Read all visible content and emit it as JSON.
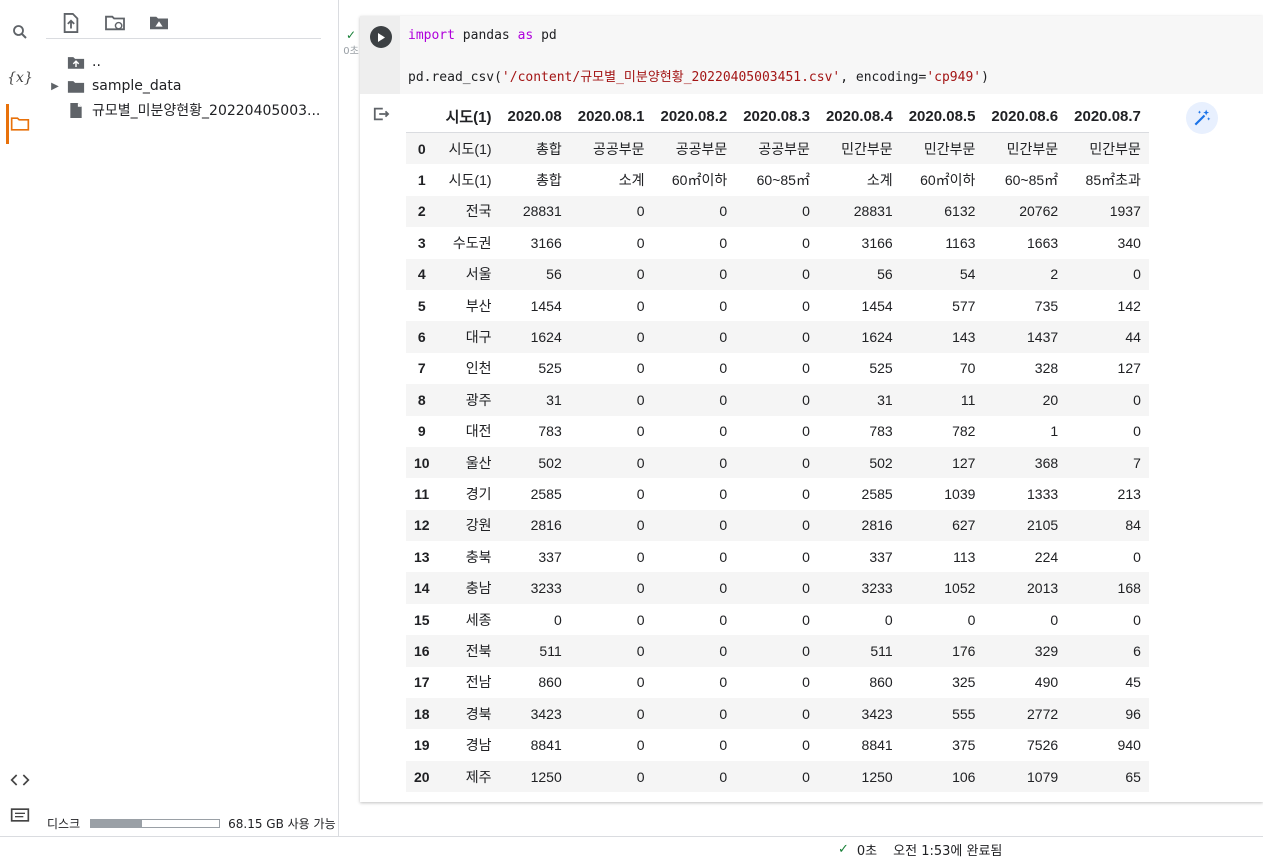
{
  "rail": {
    "icons": [
      "search-icon",
      "variables-icon",
      "folder-icon",
      "code-snippets-icon",
      "terminal-icon"
    ],
    "variables_label": "{x}"
  },
  "files": {
    "toolbar": [
      "upload-icon",
      "refresh-icon",
      "drive-icon"
    ],
    "items": [
      {
        "label": "..",
        "icon": "folder-up-icon"
      },
      {
        "label": "sample_data",
        "icon": "folder-icon"
      },
      {
        "label": "규모별_미분양현황_20220405003...",
        "icon": "file-icon"
      }
    ],
    "disk": {
      "label": "디스크",
      "usage_fraction": 0.4,
      "free_text": "68.15 GB 사용 가능"
    }
  },
  "cell": {
    "status": {
      "check": "✓",
      "time": "0초"
    },
    "code": {
      "line1": {
        "kw1": "import",
        "mid": " pandas ",
        "kw2": "as",
        "end": " pd"
      },
      "line2": {
        "pre": "pd.read_csv(",
        "str1": "'/content/규모별_미분양현황_20220405003451.csv'",
        "mid": ", encoding=",
        "str2": "'cp949'",
        "end": ")"
      }
    }
  },
  "table": {
    "columns": [
      "",
      "시도(1)",
      "2020.08",
      "2020.08.1",
      "2020.08.2",
      "2020.08.3",
      "2020.08.4",
      "2020.08.5",
      "2020.08.6",
      "2020.08.7"
    ],
    "rows": [
      [
        "0",
        "시도(1)",
        "총합",
        "공공부문",
        "공공부문",
        "공공부문",
        "민간부문",
        "민간부문",
        "민간부문",
        "민간부문"
      ],
      [
        "1",
        "시도(1)",
        "총합",
        "소계",
        "60㎡이하",
        "60~85㎡",
        "소계",
        "60㎡이하",
        "60~85㎡",
        "85㎡초과"
      ],
      [
        "2",
        "전국",
        "28831",
        "0",
        "0",
        "0",
        "28831",
        "6132",
        "20762",
        "1937"
      ],
      [
        "3",
        "수도권",
        "3166",
        "0",
        "0",
        "0",
        "3166",
        "1163",
        "1663",
        "340"
      ],
      [
        "4",
        "서울",
        "56",
        "0",
        "0",
        "0",
        "56",
        "54",
        "2",
        "0"
      ],
      [
        "5",
        "부산",
        "1454",
        "0",
        "0",
        "0",
        "1454",
        "577",
        "735",
        "142"
      ],
      [
        "6",
        "대구",
        "1624",
        "0",
        "0",
        "0",
        "1624",
        "143",
        "1437",
        "44"
      ],
      [
        "7",
        "인천",
        "525",
        "0",
        "0",
        "0",
        "525",
        "70",
        "328",
        "127"
      ],
      [
        "8",
        "광주",
        "31",
        "0",
        "0",
        "0",
        "31",
        "11",
        "20",
        "0"
      ],
      [
        "9",
        "대전",
        "783",
        "0",
        "0",
        "0",
        "783",
        "782",
        "1",
        "0"
      ],
      [
        "10",
        "울산",
        "502",
        "0",
        "0",
        "0",
        "502",
        "127",
        "368",
        "7"
      ],
      [
        "11",
        "경기",
        "2585",
        "0",
        "0",
        "0",
        "2585",
        "1039",
        "1333",
        "213"
      ],
      [
        "12",
        "강원",
        "2816",
        "0",
        "0",
        "0",
        "2816",
        "627",
        "2105",
        "84"
      ],
      [
        "13",
        "충북",
        "337",
        "0",
        "0",
        "0",
        "337",
        "113",
        "224",
        "0"
      ],
      [
        "14",
        "충남",
        "3233",
        "0",
        "0",
        "0",
        "3233",
        "1052",
        "2013",
        "168"
      ],
      [
        "15",
        "세종",
        "0",
        "0",
        "0",
        "0",
        "0",
        "0",
        "0",
        "0"
      ],
      [
        "16",
        "전북",
        "511",
        "0",
        "0",
        "0",
        "511",
        "176",
        "329",
        "6"
      ],
      [
        "17",
        "전남",
        "860",
        "0",
        "0",
        "0",
        "860",
        "325",
        "490",
        "45"
      ],
      [
        "18",
        "경북",
        "3423",
        "0",
        "0",
        "0",
        "3423",
        "555",
        "2772",
        "96"
      ],
      [
        "19",
        "경남",
        "8841",
        "0",
        "0",
        "0",
        "8841",
        "375",
        "7526",
        "940"
      ],
      [
        "20",
        "제주",
        "1250",
        "0",
        "0",
        "0",
        "1250",
        "106",
        "1079",
        "65"
      ]
    ]
  },
  "statusbar": {
    "check": "✓",
    "elapsed": "0초",
    "completed": "오전 1:53에 완료됨"
  },
  "colors": {
    "accent": "#e8710a",
    "keyword": "#af00db",
    "string": "#a31515",
    "check": "#188038"
  }
}
